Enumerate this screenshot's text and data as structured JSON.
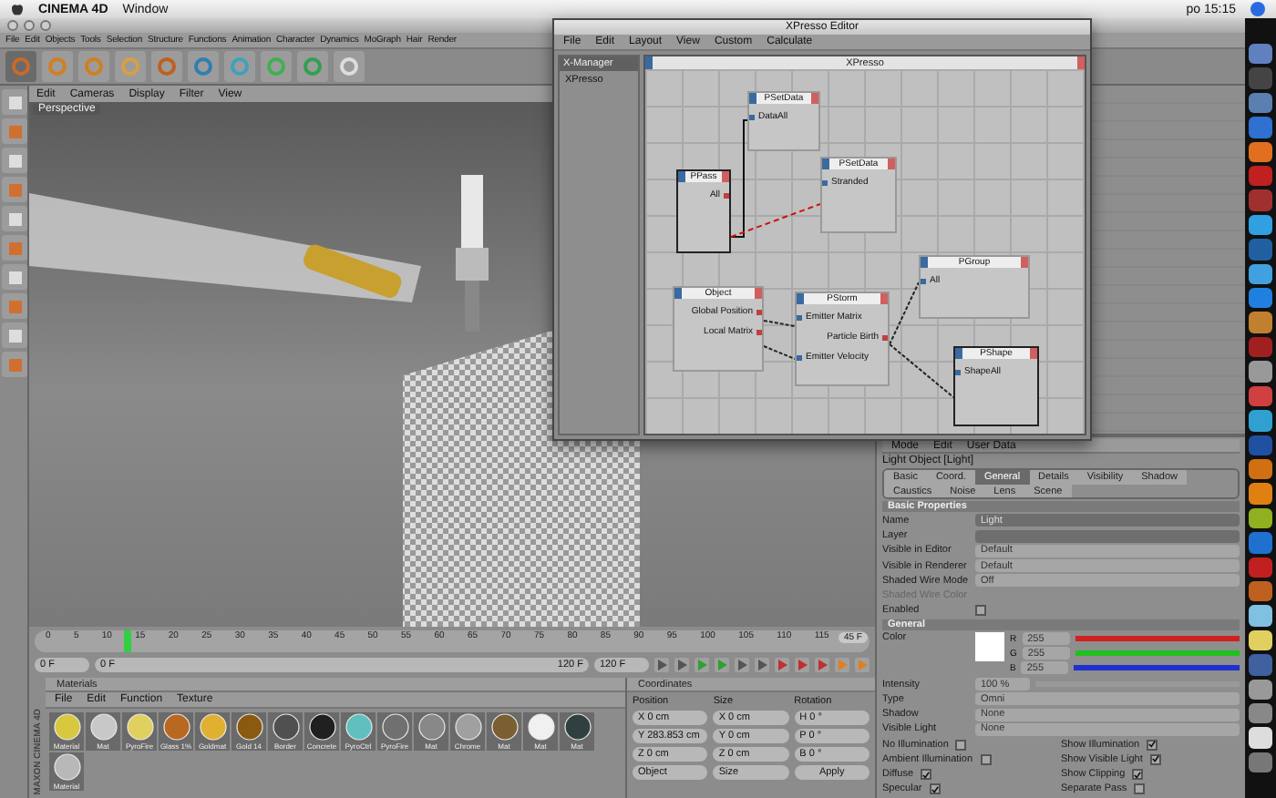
{
  "system_menu": {
    "app": "CINEMA 4D",
    "items": [
      "Window"
    ],
    "clock": "po 15:15"
  },
  "main_menu": [
    "File",
    "Edit",
    "Objects",
    "Tools",
    "Selection",
    "Structure",
    "Functions",
    "Animation",
    "Character",
    "Dynamics",
    "MoGraph",
    "Hair",
    "Render"
  ],
  "viewport": {
    "menu": [
      "Edit",
      "Cameras",
      "Display",
      "Filter",
      "View"
    ],
    "label": "Perspective"
  },
  "xpresso": {
    "title": "XPresso Editor",
    "menu": [
      "File",
      "Edit",
      "Layout",
      "View",
      "Custom",
      "Calculate"
    ],
    "manager": {
      "title": "X-Manager",
      "items": [
        {
          "label": "XPresso",
          "selected": false
        }
      ]
    },
    "graph": {
      "title": "XPresso",
      "nodes": [
        {
          "title": "PSetData",
          "selected": false,
          "ports": [
            {
              "label": "DataAll",
              "kind": "input"
            }
          ]
        },
        {
          "title": "PPass",
          "selected": true,
          "ports": [
            {
              "label": "All",
              "kind": "output"
            }
          ]
        },
        {
          "title": "PSetData",
          "selected": false,
          "ports": [
            {
              "label": "Stranded",
              "kind": "input"
            }
          ]
        },
        {
          "title": "Object",
          "selected": false,
          "ports": [
            {
              "label": "Global Position",
              "kind": "output"
            },
            {
              "label": "Local Matrix",
              "kind": "output"
            }
          ]
        },
        {
          "title": "PStorm",
          "selected": false,
          "ports": [
            {
              "label": "Emitter Matrix",
              "kind": "input"
            },
            {
              "label": "Particle Birth",
              "kind": "output"
            },
            {
              "label": "Emitter Velocity",
              "kind": "input"
            }
          ]
        },
        {
          "title": "PGroup",
          "selected": false,
          "ports": [
            {
              "label": "All",
              "kind": "input"
            }
          ]
        },
        {
          "title": "PShape",
          "selected": true,
          "ports": [
            {
              "label": "ShapeAll",
              "kind": "input"
            }
          ]
        }
      ]
    }
  },
  "attributes": {
    "header": [
      "Mode",
      "Edit",
      "User Data"
    ],
    "object": "Light Object [Light]",
    "tabs": [
      {
        "label": "Basic",
        "selected": false
      },
      {
        "label": "Coord.",
        "selected": false
      },
      {
        "label": "General",
        "selected": true
      },
      {
        "label": "Details",
        "selected": false
      },
      {
        "label": "Visibility",
        "selected": false
      },
      {
        "label": "Shadow",
        "selected": false
      },
      {
        "label": "Caustics",
        "selected": false
      },
      {
        "label": "Noise",
        "selected": false
      },
      {
        "label": "Lens",
        "selected": false
      },
      {
        "label": "Scene",
        "selected": false
      }
    ],
    "sections": [
      {
        "title": "Basic Properties",
        "rows": [
          {
            "kind": "text",
            "label": "Name",
            "value": "Light"
          },
          {
            "kind": "text",
            "label": "Layer"
          },
          {
            "kind": "select",
            "label": "Visible in Editor",
            "value": "Default"
          },
          {
            "kind": "select",
            "label": "Visible in Renderer",
            "value": "Default"
          },
          {
            "kind": "select",
            "label": "Shaded Wire Mode",
            "value": "Off"
          },
          {
            "kind": "color",
            "label": "Shaded Wire Color",
            "disabled": true
          },
          {
            "kind": "check",
            "label": "Enabled",
            "checked": false
          }
        ]
      },
      {
        "title": "General",
        "rows": [
          {
            "kind": "rgb",
            "label": "Color",
            "channels": [
              {
                "name": "R",
                "value": "255",
                "level": 1,
                "color": "#d02020"
              },
              {
                "name": "G",
                "value": "255",
                "level": 1,
                "color": "#20c020"
              },
              {
                "name": "B",
                "value": "255",
                "level": 1,
                "color": "#2030d0"
              }
            ]
          },
          {
            "kind": "percent",
            "label": "Intensity",
            "value": "100 %",
            "level": 1
          },
          {
            "kind": "select",
            "label": "Type",
            "value": "Omni"
          },
          {
            "kind": "select",
            "label": "Shadow",
            "value": "None"
          },
          {
            "kind": "select",
            "label": "Visible Light",
            "value": "None"
          },
          {
            "kind": "checkpair",
            "items": [
              {
                "label": "No Illumination",
                "checked": false
              },
              {
                "label": "Show Illumination",
                "checked": true
              }
            ]
          },
          {
            "kind": "checkpair",
            "items": [
              {
                "label": "Ambient Illumination",
                "checked": false
              },
              {
                "label": "Show Visible Light",
                "checked": true
              }
            ]
          },
          {
            "kind": "checkpair",
            "items": [
              {
                "label": "Diffuse",
                "checked": true
              },
              {
                "label": "Show Clipping",
                "checked": true
              }
            ]
          },
          {
            "kind": "checkpair",
            "items": [
              {
                "label": "Specular",
                "checked": true
              },
              {
                "label": "Separate Pass",
                "checked": false
              }
            ]
          }
        ]
      }
    ]
  },
  "timeline": {
    "ticks": [
      "0",
      "5",
      "10",
      "15",
      "20",
      "25",
      "30",
      "35",
      "40",
      "45",
      "50",
      "55",
      "60",
      "65",
      "70",
      "75",
      "80",
      "85",
      "90",
      "95",
      "100",
      "105",
      "110",
      "115"
    ],
    "level": 0.1,
    "end_field": "45 F",
    "start": "0 F",
    "range": {
      "start": "0 F",
      "end": "120 F",
      "level": 1
    },
    "max": "120 F"
  },
  "materials": {
    "title": "Materials",
    "menu": [
      "File",
      "Edit",
      "Function",
      "Texture"
    ],
    "items": [
      {
        "label": "Material",
        "color": "#d8c840"
      },
      {
        "label": "Mat",
        "color": "#c8c8c8"
      },
      {
        "label": "PyroFire",
        "color": "#e0d060"
      },
      {
        "label": "Glass 1%",
        "color": "#b86820"
      },
      {
        "label": "Goldmat",
        "color": "#e0b030"
      },
      {
        "label": "Gold 14",
        "color": "#8a5a10"
      },
      {
        "label": "Border",
        "color": "#505050"
      },
      {
        "label": "Concrete",
        "color": "#202020"
      },
      {
        "label": "PyroCtrl",
        "color": "#60c0c0"
      },
      {
        "label": "PyroFire",
        "color": "#707070"
      },
      {
        "label": "Mat",
        "color": "#888888"
      },
      {
        "label": "Chrome",
        "color": "#a0a0a0"
      },
      {
        "label": "Mat",
        "color": "#7a6030"
      },
      {
        "label": "Mat",
        "color": "#f0f0f0"
      },
      {
        "label": "Mat",
        "color": "#304040"
      },
      {
        "label": "Material",
        "color": "#b8b8b8"
      }
    ]
  },
  "coordinates": {
    "title": "Coordinates",
    "columns": [
      "Position",
      "Size",
      "Rotation"
    ],
    "rows": [
      {
        "axis": "X",
        "position": "0 cm",
        "size_axis": "X",
        "size": "0 cm",
        "rot_axis": "H",
        "rotation": "0 °"
      },
      {
        "axis": "Y",
        "position": "283.853 cm",
        "size_axis": "Y",
        "size": "0 cm",
        "rot_axis": "P",
        "rotation": "0 °"
      },
      {
        "axis": "Z",
        "position": "0 cm",
        "size_axis": "Z",
        "size": "0 cm",
        "rot_axis": "B",
        "rotation": "0 °"
      }
    ],
    "modes": [
      "Object",
      "Size"
    ],
    "apply": "Apply"
  },
  "brand": "MAXON CINEMA 4D"
}
